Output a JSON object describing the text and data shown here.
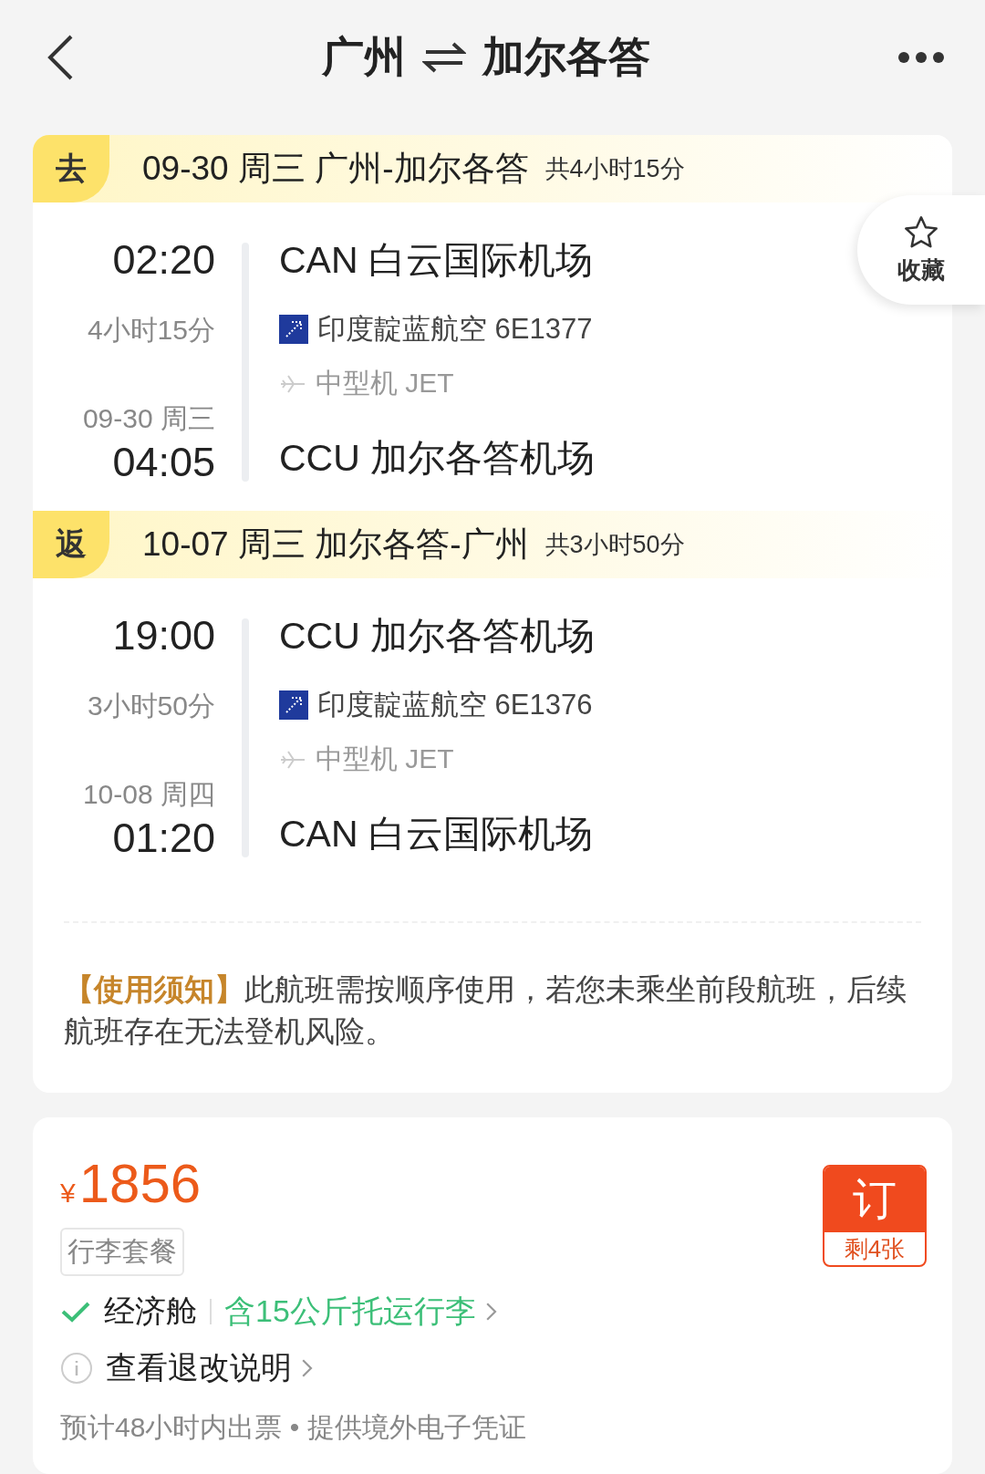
{
  "header": {
    "from": "广州",
    "to": "加尔各答"
  },
  "favorite": {
    "label": "收藏"
  },
  "legs": [
    {
      "tag": "去",
      "date_route": "09-30 周三 广州-加尔各答",
      "total": "共4小时15分",
      "dep_time": "02:20",
      "dep_airport": "CAN 白云国际机场",
      "duration": "4小时15分",
      "airline": "印度靛蓝航空 6E1377",
      "aircraft": "中型机 JET",
      "arr_date": "09-30 周三",
      "arr_time": "04:05",
      "arr_airport": "CCU 加尔各答机场"
    },
    {
      "tag": "返",
      "date_route": "10-07 周三 加尔各答-广州",
      "total": "共3小时50分",
      "dep_time": "19:00",
      "dep_airport": "CCU 加尔各答机场",
      "duration": "3小时50分",
      "airline": "印度靛蓝航空 6E1376",
      "aircraft": "中型机 JET",
      "arr_date": "10-08 周四",
      "arr_time": "01:20",
      "arr_airport": "CAN 白云国际机场"
    }
  ],
  "notice": "**【使用须知】**此航班需按顺序使用，若您未乘坐前段航班，后续航班存在无法登机风险。",
  "offer": {
    "currency": "¥",
    "price": "1856",
    "package": "行李套餐",
    "cabin": "经济舱",
    "baggage": "含15公斤托运行李",
    "refund": "查看退改说明",
    "footnote": "预计48小时内出票 • 提供境外电子凭证",
    "book_label": "订",
    "remaining": "剩4张"
  }
}
